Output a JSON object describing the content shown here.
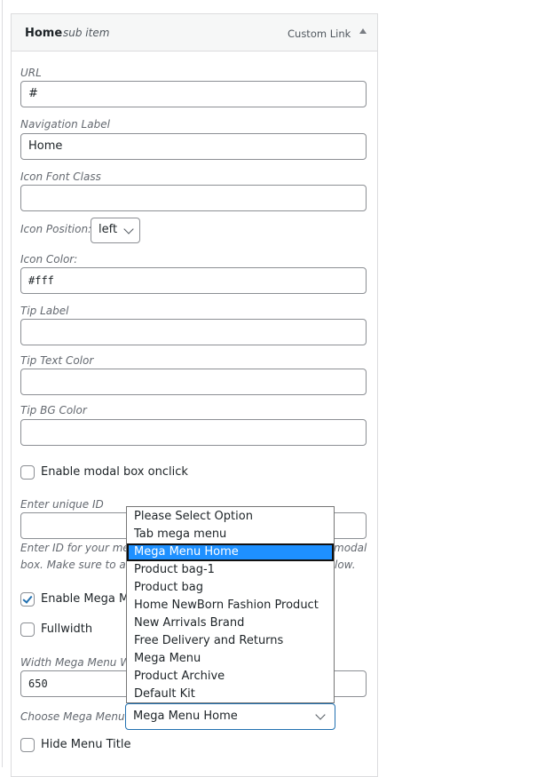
{
  "header": {
    "title": "Home",
    "subtitle": "sub item",
    "type": "Custom Link",
    "toggle_icon": "triangle-up-icon"
  },
  "fields": {
    "url": {
      "label": "URL",
      "value": "#"
    },
    "nav_label": {
      "label": "Navigation Label",
      "value": "Home"
    },
    "icon_font_class": {
      "label": "Icon Font Class",
      "value": ""
    },
    "icon_position": {
      "label": "Icon Position:",
      "value": "left"
    },
    "icon_color": {
      "label": "Icon Color:",
      "value": "#fff"
    },
    "tip_label": {
      "label": "Tip Label",
      "value": ""
    },
    "tip_text_color": {
      "label": "Tip Text Color",
      "value": ""
    },
    "tip_bg_color": {
      "label": "Tip BG Color",
      "value": ""
    },
    "enable_modal": {
      "label": "Enable modal box onclick",
      "checked": false
    },
    "unique_id": {
      "label": "Enter unique ID",
      "value": "",
      "help_1a": "Enter ID for your men",
      "help_1b": "modal",
      "help_2a": "box. Make sure to ad",
      "help_2b": "low."
    },
    "enable_mega": {
      "label": "Enable Mega Me",
      "checked": true
    },
    "fullwidth": {
      "label": "Fullwidth",
      "checked": false
    },
    "width_mega": {
      "label": "Width Mega Menu W",
      "value": "650"
    },
    "choose_mega": {
      "label": "Choose Mega Menu:",
      "value": "Mega Menu Home"
    },
    "hide_title": {
      "label": "Hide Menu Title",
      "checked": false
    }
  },
  "dropdown": {
    "selected_index": 2,
    "options": [
      "Please Select Option",
      "Tab mega menu",
      "Mega Menu Home",
      "Product bag-1",
      "Product bag",
      "Home NewBorn Fashion Product",
      "New Arrivals Brand",
      "Free Delivery and Returns",
      "Mega Menu",
      "Product Archive",
      "Default Kit"
    ]
  },
  "colors": {
    "highlight": "#1e90ff",
    "focus": "#2271b1"
  }
}
